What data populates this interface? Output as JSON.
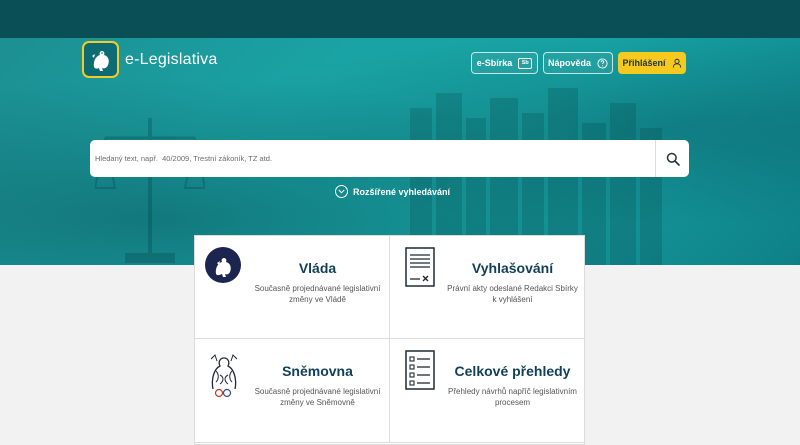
{
  "app": {
    "title": "e-Legislativa"
  },
  "header": {
    "sbirka_label": "e-Sbírka",
    "sbirka_badge": "Sb",
    "napoveda_label": "Nápověda",
    "login_label": "Přihlášení"
  },
  "search": {
    "placeholder": "Hledaný text, např.  40/2009, Trestní zákoník, TZ atd.",
    "value": ""
  },
  "advanced_search": {
    "label": "Rozšířené vyhledávání"
  },
  "cards": [
    {
      "title": "Vláda",
      "description": "Současně projednávané legislativní změny ve Vládě"
    },
    {
      "title": "Vyhlašování",
      "description": "Právní akty odeslané Redakci Sbírky k vyhlášení"
    },
    {
      "title": "Sněmovna",
      "description": "Současně projednávané legislativní změny ve Sněmovně"
    },
    {
      "title": "Celkové přehledy",
      "description": "Přehledy návrhů napříč legislativním procesem"
    }
  ],
  "colors": {
    "topbar": "#0a4f55",
    "hero": "#1aa3a4",
    "accent_yellow": "#f6c91e",
    "card_title": "#113f5a"
  }
}
